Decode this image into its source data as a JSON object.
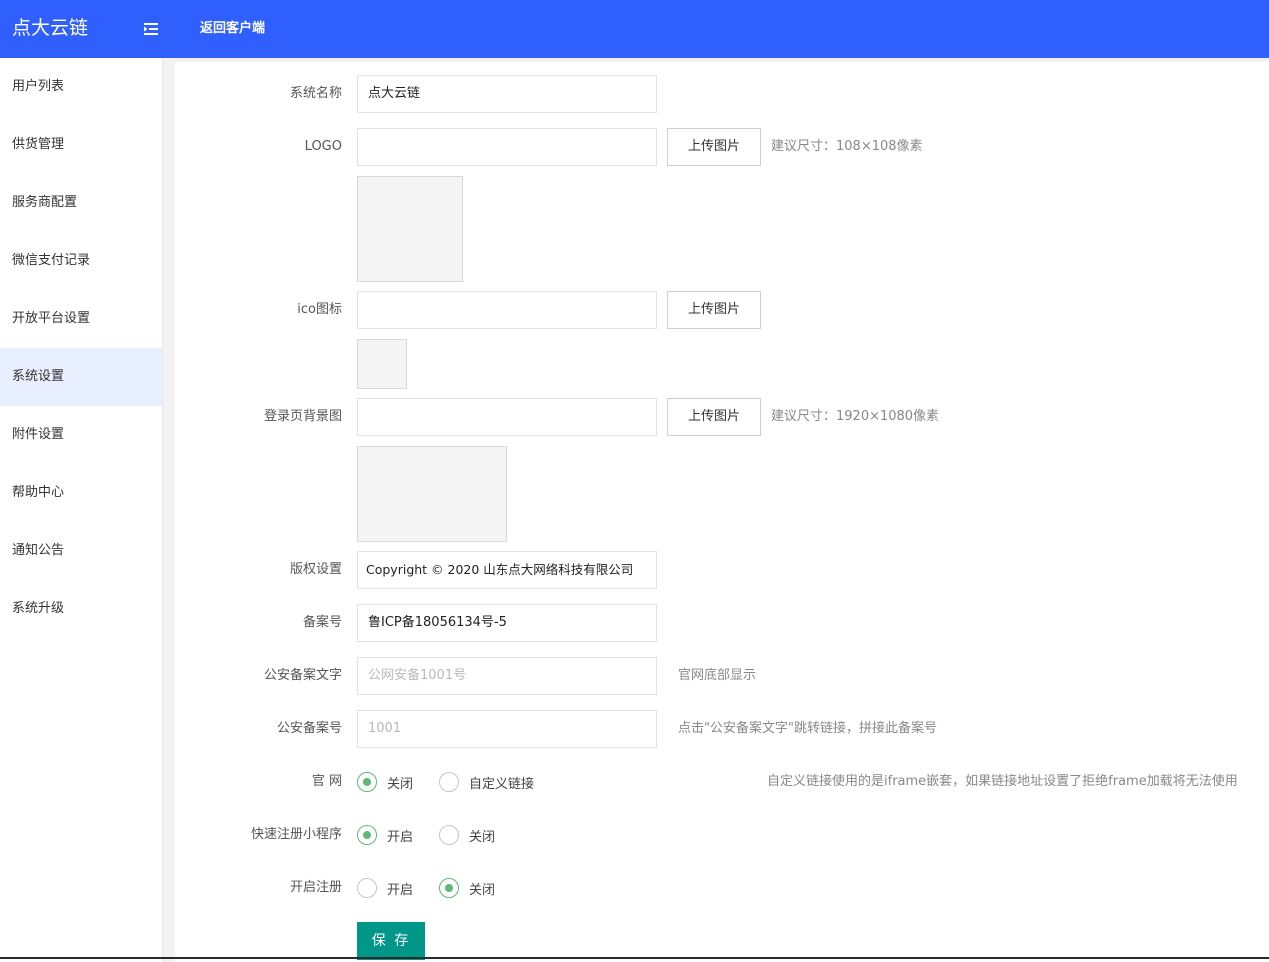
{
  "header": {
    "brand": "点大云链",
    "back_label": "返回客户端"
  },
  "sidebar": {
    "items": [
      {
        "label": "用户列表",
        "active": false
      },
      {
        "label": "供货管理",
        "active": false
      },
      {
        "label": "服务商配置",
        "active": false
      },
      {
        "label": "微信支付记录",
        "active": false
      },
      {
        "label": "开放平台设置",
        "active": false
      },
      {
        "label": "系统设置",
        "active": true
      },
      {
        "label": "附件设置",
        "active": false
      },
      {
        "label": "帮助中心",
        "active": false
      },
      {
        "label": "通知公告",
        "active": false
      },
      {
        "label": "系统升级",
        "active": false
      }
    ]
  },
  "form": {
    "system_name": {
      "label": "系统名称",
      "value": "点大云链"
    },
    "logo": {
      "label": "LOGO",
      "value": "",
      "upload_label": "上传图片",
      "hint": "建议尺寸：108×108像素"
    },
    "ico": {
      "label": "ico图标",
      "value": "",
      "upload_label": "上传图片"
    },
    "login_bg": {
      "label": "登录页背景图",
      "value": "",
      "upload_label": "上传图片",
      "hint": "建议尺寸：1920×1080像素"
    },
    "copyright": {
      "label": "版权设置",
      "value": "Copyright © 2020 山东点大网络科技有限公司"
    },
    "icp": {
      "label": "备案号",
      "value": "鲁ICP备18056134号-5"
    },
    "police_text": {
      "label": "公安备案文字",
      "placeholder": "公网安备1001号",
      "hint": "官网底部显示"
    },
    "police_no": {
      "label": "公安备案号",
      "placeholder": "1001",
      "hint": "点击\"公安备案文字\"跳转链接，拼接此备案号"
    },
    "website": {
      "label": "官 网",
      "options": [
        "关闭",
        "自定义链接"
      ],
      "selected": "关闭",
      "hint": "自定义链接使用的是iframe嵌套，如果链接地址设置了拒绝frame加载将无法使用"
    },
    "quick_register": {
      "label": "快速注册小程序",
      "options": [
        "开启",
        "关闭"
      ],
      "selected": "开启"
    },
    "open_register": {
      "label": "开启注册",
      "options": [
        "开启",
        "关闭"
      ],
      "selected": "关闭"
    },
    "save_label": "保 存"
  },
  "colors": {
    "header_bg": "#2f5ffc",
    "active_item_bg": "#e8efff",
    "radio_accent": "#5fb878",
    "save_button": "#009688"
  }
}
